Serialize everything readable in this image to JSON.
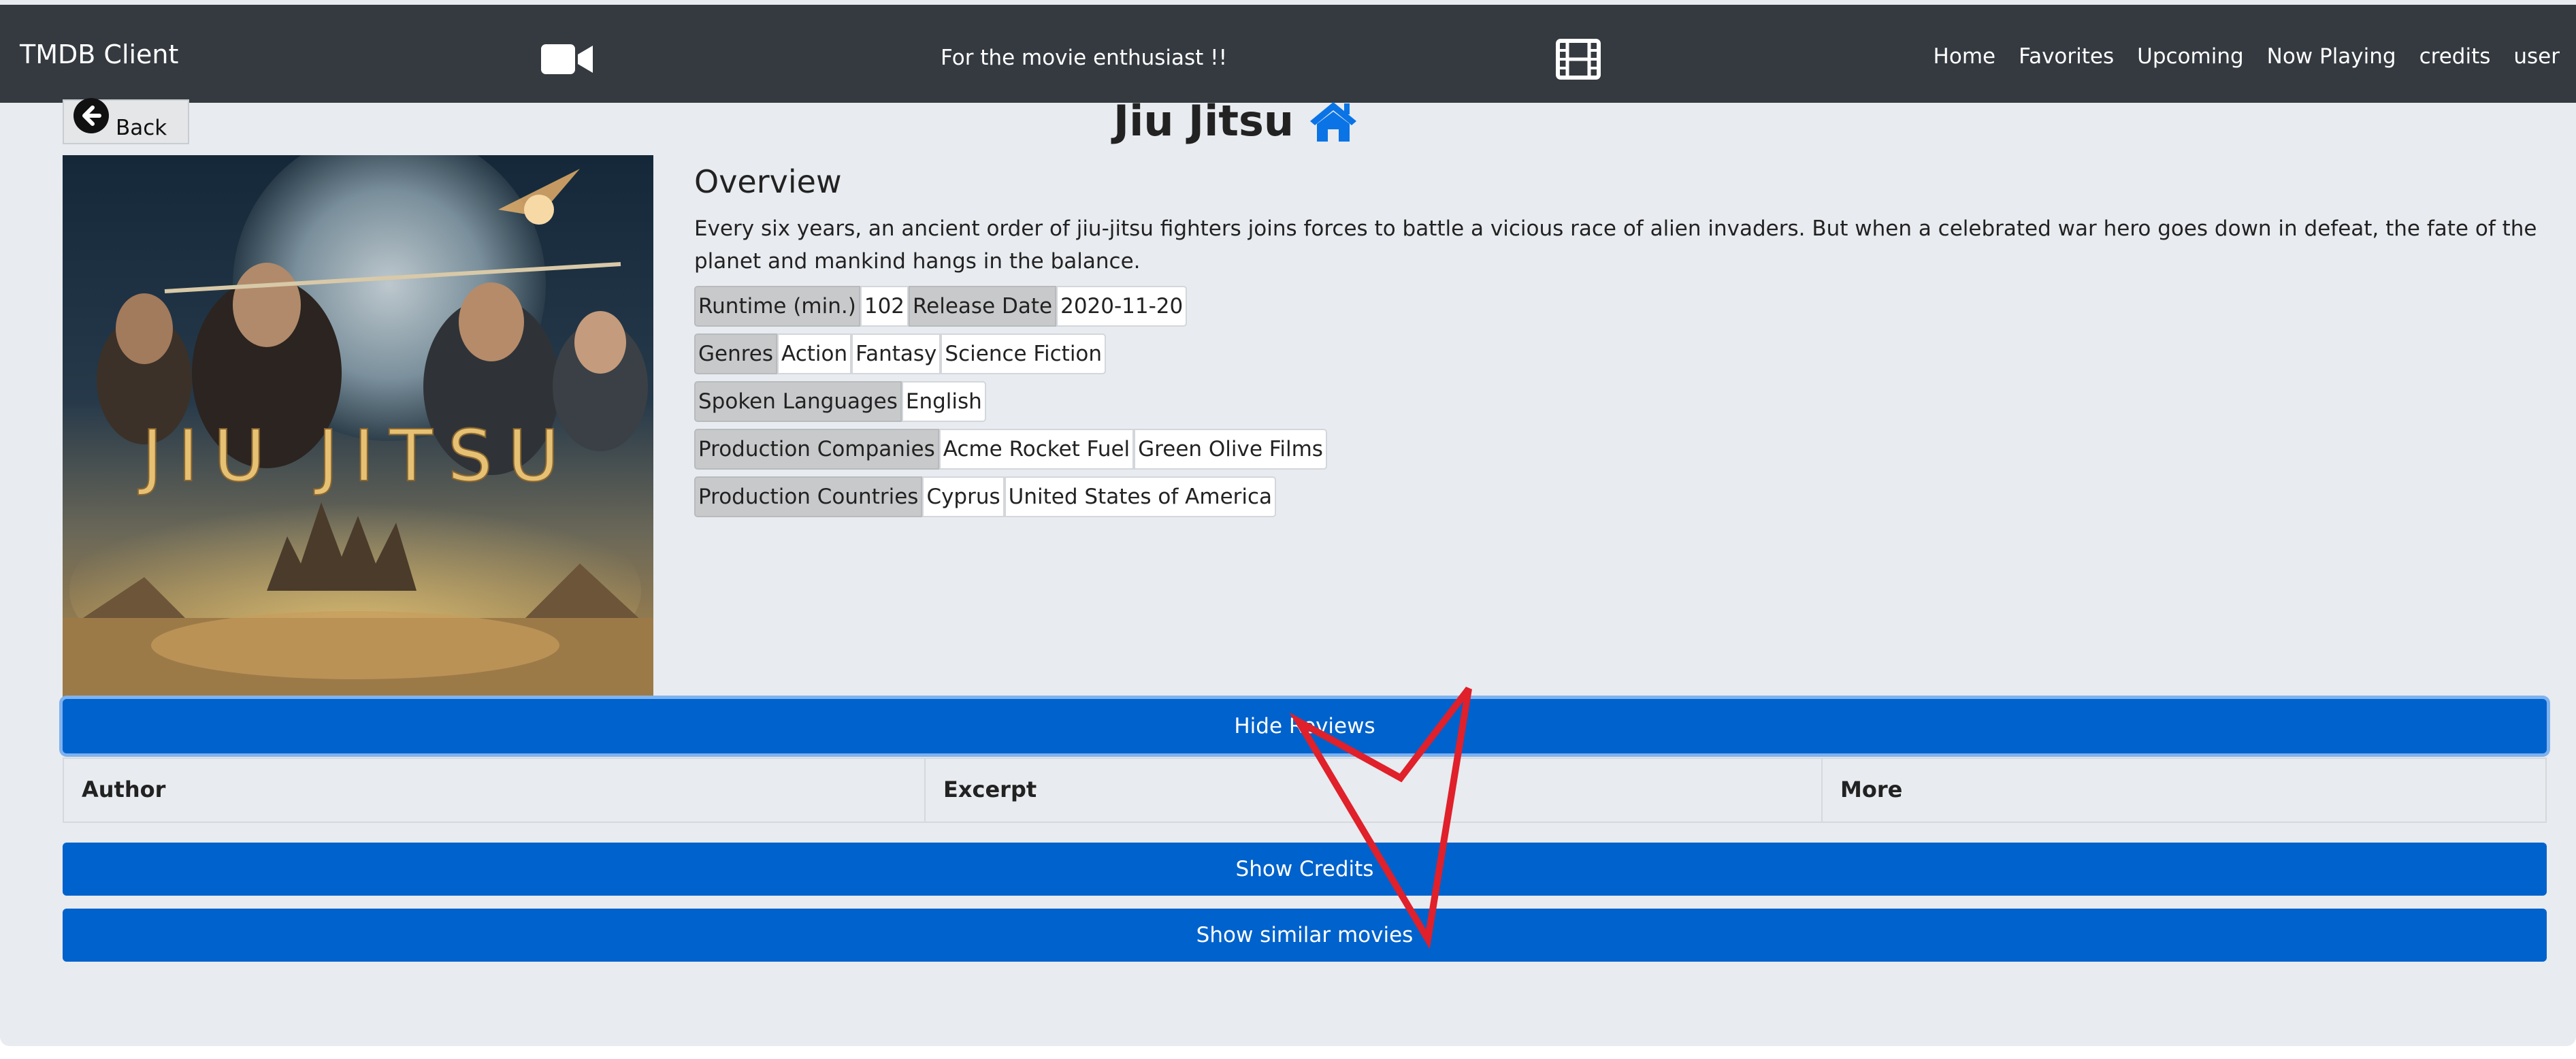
{
  "navbar": {
    "brand": "TMDB Client",
    "tagline": "For the movie enthusiast !!",
    "links": [
      "Home",
      "Favorites",
      "Upcoming",
      "Now Playing",
      "credits",
      "user"
    ],
    "icons": [
      "video-camera-icon",
      "film-strip-icon"
    ]
  },
  "back_button": {
    "label": "Back",
    "icon": "arrow-left-circle-icon"
  },
  "movie": {
    "title": "Jiu Jitsu",
    "title_icon": "home-icon",
    "poster": {
      "title_text": "JIU JITSU"
    },
    "overview_heading": "Overview",
    "overview": "Every six years, an ancient order of jiu-jitsu fighters joins forces to battle a vicious race of alien invaders. But when a celebrated war hero goes down in defeat, the fate of the planet and mankind hangs in the balance.",
    "details": {
      "runtime_label": "Runtime (min.)",
      "runtime": "102",
      "release_label": "Release Date",
      "release_date": "2020-11-20",
      "genres_label": "Genres",
      "genres": [
        "Action",
        "Fantasy",
        "Science Fiction"
      ],
      "languages_label": "Spoken Languages",
      "languages": [
        "English"
      ],
      "companies_label": "Production Companies",
      "companies": [
        "Acme Rocket Fuel",
        "Green Olive Films"
      ],
      "countries_label": "Production Countries",
      "countries": [
        "Cyprus",
        "United States of America"
      ]
    }
  },
  "reviews": {
    "toggle_label": "Hide Reviews",
    "columns": [
      "Author",
      "Excerpt",
      "More"
    ]
  },
  "actions": {
    "credits_label": "Show Credits",
    "similar_label": "Show similar movies"
  },
  "colors": {
    "navbar_bg": "#343a40",
    "page_bg": "#e8ebef",
    "primary": "#0062cc",
    "chip_key_bg": "#c8c9cb",
    "annotation": "#e0202a",
    "home_icon": "#0a74e6"
  }
}
